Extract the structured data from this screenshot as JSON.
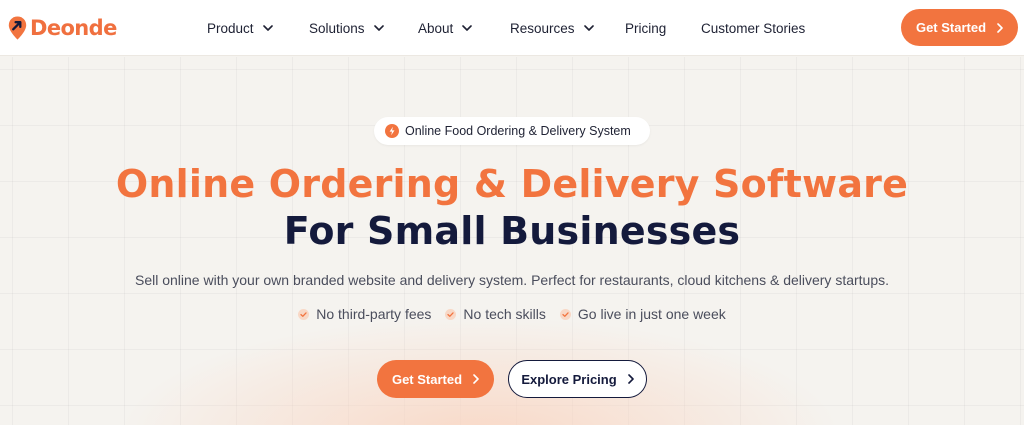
{
  "brand": {
    "name": "Deonde",
    "accent_color": "#f2743f",
    "dark_color": "#141a3c"
  },
  "nav": {
    "items": [
      {
        "label": "Product",
        "has_dropdown": true
      },
      {
        "label": "Solutions",
        "has_dropdown": true
      },
      {
        "label": "About",
        "has_dropdown": true
      },
      {
        "label": "Resources",
        "has_dropdown": true
      },
      {
        "label": "Pricing",
        "has_dropdown": false
      },
      {
        "label": "Customer Stories",
        "has_dropdown": false
      }
    ],
    "cta_label": "Get Started"
  },
  "hero": {
    "badge": {
      "icon": "lightning-icon",
      "text": "Online Food Ordering & Delivery System"
    },
    "title_line1": "Online Ordering & Delivery Software",
    "title_line2": "For Small Businesses",
    "subtitle": "Sell online with your own branded website and delivery system. Perfect for restaurants, cloud kitchens & delivery startups.",
    "features": [
      "No third-party fees",
      "No tech skills",
      "Go live in just one week"
    ],
    "primary_cta": "Get Started",
    "secondary_cta": "Explore Pricing"
  }
}
